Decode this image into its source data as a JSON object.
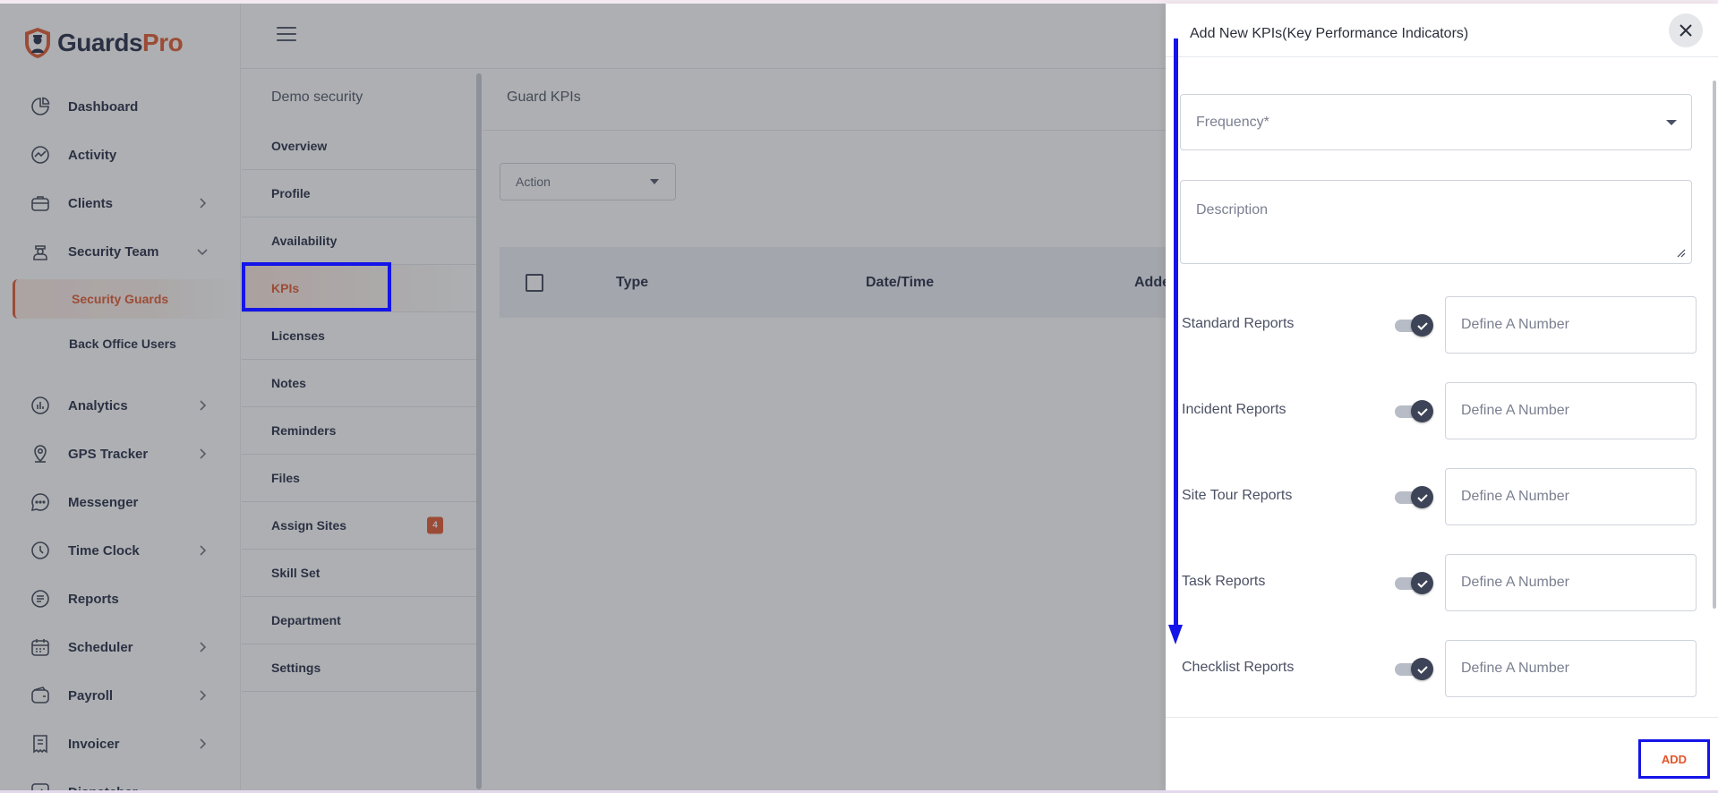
{
  "app": {
    "brand": {
      "name_part1": "Guards",
      "name_part2": "Pro",
      "accent": "#e2552a"
    }
  },
  "sidebar": {
    "items": [
      {
        "label": "Dashboard",
        "icon": "pie-chart-icon",
        "has_children": false
      },
      {
        "label": "Activity",
        "icon": "activity-icon",
        "has_children": false
      },
      {
        "label": "Clients",
        "icon": "briefcase-icon",
        "has_children": true
      },
      {
        "label": "Security Team",
        "icon": "security-guard-icon",
        "has_children": true,
        "expanded": true
      },
      {
        "label": "Analytics",
        "icon": "bar-chart-icon",
        "has_children": true
      },
      {
        "label": "GPS Tracker",
        "icon": "location-pin-icon",
        "has_children": true
      },
      {
        "label": "Messenger",
        "icon": "chat-bubble-icon",
        "has_children": false
      },
      {
        "label": "Time Clock",
        "icon": "clock-icon",
        "has_children": true
      },
      {
        "label": "Reports",
        "icon": "report-document-icon",
        "has_children": false
      },
      {
        "label": "Scheduler",
        "icon": "calendar-icon",
        "has_children": true
      },
      {
        "label": "Payroll",
        "icon": "wallet-icon",
        "has_children": true
      },
      {
        "label": "Invoicer",
        "icon": "invoice-icon",
        "has_children": true
      },
      {
        "label": "Dispatcher",
        "icon": "dispatch-icon",
        "has_children": false
      }
    ],
    "security_team_children": [
      {
        "label": "Security Guards",
        "active": true
      },
      {
        "label": "Back Office Users",
        "active": false
      }
    ]
  },
  "subnav": {
    "title": "Demo security",
    "items": [
      {
        "label": "Overview"
      },
      {
        "label": "Profile"
      },
      {
        "label": "Availability"
      },
      {
        "label": "KPIs",
        "active": true
      },
      {
        "label": "Licenses"
      },
      {
        "label": "Notes"
      },
      {
        "label": "Reminders"
      },
      {
        "label": "Files"
      },
      {
        "label": "Assign Sites",
        "badge": "4"
      },
      {
        "label": "Skill Set"
      },
      {
        "label": "Department"
      },
      {
        "label": "Settings"
      }
    ]
  },
  "content": {
    "title": "Guard KPIs",
    "action_select": "Action",
    "table_headers": [
      "Type",
      "Date/Time",
      "Added"
    ]
  },
  "drawer": {
    "title": "Add New KPIs(Key Performance Indicators)",
    "frequency_label": "Frequency*",
    "description_label": "Description",
    "kpi_rows": [
      {
        "label": "Standard Reports",
        "enabled": true,
        "placeholder": "Define A Number"
      },
      {
        "label": "Incident Reports",
        "enabled": true,
        "placeholder": "Define A Number"
      },
      {
        "label": "Site Tour Reports",
        "enabled": true,
        "placeholder": "Define A Number"
      },
      {
        "label": "Task Reports",
        "enabled": true,
        "placeholder": "Define A Number"
      },
      {
        "label": "Checklist Reports",
        "enabled": true,
        "placeholder": "Define A Number"
      }
    ],
    "add_button": "ADD"
  },
  "colors": {
    "brand_orange": "#e2552a",
    "navy": "#1f2740",
    "annotation_blue": "#1414e8",
    "toggle_knob": "#3d4457"
  }
}
